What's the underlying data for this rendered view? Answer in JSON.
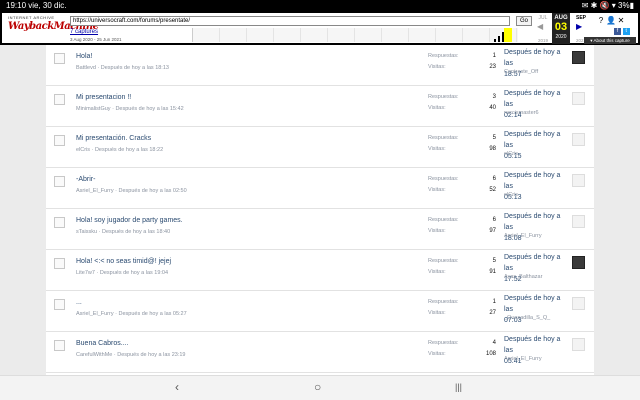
{
  "statusbar": {
    "time_date": "19:10  vie, 30 dic.",
    "right": "✉ ✱ 🔇 ▾ 3%▮"
  },
  "wayback": {
    "logo_top": "INTERNET ARCHIVE",
    "logo_main": "WaybackMachine",
    "url": "https://universocraft.com/forums/presentate/",
    "go_label": "Go",
    "captures": "7 captures",
    "range": "3 Aug 2020 - 25 Jun 2021",
    "calendar": {
      "prev_month": "JUL",
      "current_month": "AUG",
      "day": "03",
      "current_year": "2020",
      "next_month": "SEP",
      "prev_year": "2019",
      "next_year": "2021"
    },
    "about": "▾ About this capture"
  },
  "threads": [
    {
      "title": "Hola!",
      "author": "Battlevd",
      "time": "Después de hoy a las 18:13",
      "replies": "1",
      "views": "23",
      "last_line1": "Después de hoy a las",
      "last_line2": "18:57",
      "last_user": "Contraste_Off",
      "dark_avatar": true
    },
    {
      "title": "Mi presentacion !!",
      "author": "MinimalistGuy",
      "time": "Después de hoy a las 15:42",
      "replies": "3",
      "views": "40",
      "last_line1": "Después de hoy a las",
      "last_line2": "02:14",
      "last_user": "narcismaster6",
      "dark_avatar": false
    },
    {
      "title": "Mi presentación. Cracks",
      "author": "elCris",
      "time": "Después de hoy a las 18:22",
      "replies": "5",
      "views": "98",
      "last_line1": "Después de hoy a las",
      "last_line2": "05:15",
      "last_user": "elCris",
      "dark_avatar": false
    },
    {
      "title": "-Abrir-",
      "author": "Asriel_El_Furry",
      "time": "Después de hoy a las 02:50",
      "replies": "6",
      "views": "52",
      "last_line1": "Después de hoy a las",
      "last_line2": "05:13",
      "last_user": "elCris",
      "dark_avatar": false
    },
    {
      "title": "Hola! soy jugador de party games.",
      "author": "sTaissku",
      "time": "Después de hoy a las 18:40",
      "replies": "6",
      "views": "97",
      "last_line1": "Después de hoy a las",
      "last_line2": "18:08",
      "last_user": "Asriel_El_Furry",
      "dark_avatar": false
    },
    {
      "title": "Hola! <:< no seas timid@! jejej",
      "author": "Lite7w7",
      "time": "Después de hoy a las 19:04",
      "replies": "5",
      "views": "91",
      "last_line1": "Después de hoy a las",
      "last_line2": "17:52",
      "last_user": "Ayas_Balthazar",
      "dark_avatar": true
    },
    {
      "title": "...",
      "author": "Asriel_El_Furry",
      "time": "Después de hoy a las 05:27",
      "replies": "1",
      "views": "27",
      "last_line1": "Después de hoy a las",
      "last_line2": "07:03",
      "last_user": "_Quesadilla_S_Q_",
      "dark_avatar": false
    },
    {
      "title": "Buena Cabros....",
      "author": "CarefulWithMe",
      "time": "Después de hoy a las 23:19",
      "replies": "4",
      "views": "108",
      "last_line1": "Después de hoy a las",
      "last_line2": "05:41",
      "last_user": "Asriel_El_Furry",
      "dark_avatar": false
    }
  ],
  "labels": {
    "replies": "Respuestas:",
    "views": "Visitas:"
  },
  "navbar": {
    "back": "‹",
    "home": "○",
    "recents": "|||"
  }
}
